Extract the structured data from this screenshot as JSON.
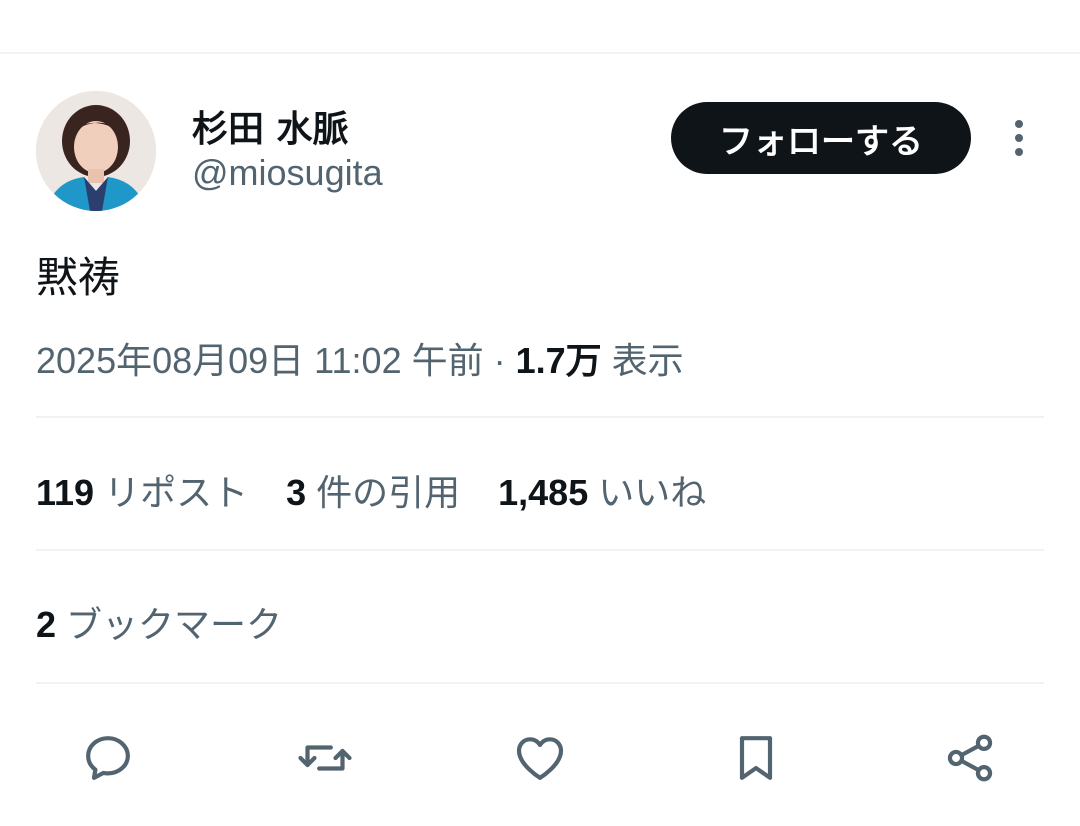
{
  "user": {
    "display_name": "杉田 水脈",
    "handle": "@miosugita"
  },
  "follow_label": "フォローする",
  "tweet": {
    "text": "黙祷",
    "timestamp": "2025年08月09日 11:02 午前",
    "separator": " · ",
    "views_count": "1.7万",
    "views_label": "表示"
  },
  "stats": {
    "reposts": {
      "count": "119",
      "label": "リポスト"
    },
    "quotes": {
      "count": "3",
      "label": "件の引用"
    },
    "likes": {
      "count": "1,485",
      "label": "いいね"
    }
  },
  "bookmarks": {
    "count": "2",
    "label": "ブックマーク"
  },
  "actions": [
    {
      "icon": "reply-icon"
    },
    {
      "icon": "repost-icon"
    },
    {
      "icon": "like-icon"
    },
    {
      "icon": "bookmark-icon"
    },
    {
      "icon": "share-icon"
    }
  ],
  "colors": {
    "text_primary": "#0f1419",
    "text_secondary": "#536471",
    "divider": "#eff3f4",
    "button_bg": "#0f1419"
  }
}
